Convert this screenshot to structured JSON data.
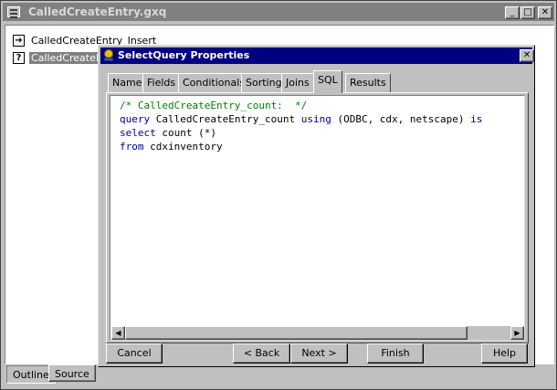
{
  "outer_window": {
    "title": "CalledCreateEntry.gxq",
    "minimize": "_",
    "maximize": "□",
    "close": "✕",
    "tree": [
      {
        "icon": "insert-query-icon",
        "glyph": "➔",
        "label": "CalledCreateEntry_Insert"
      },
      {
        "icon": "query-icon",
        "glyph": "?",
        "label": "CalledCreateEn"
      }
    ],
    "tabs": [
      "Outline",
      "Source"
    ]
  },
  "dialog": {
    "title": "SelectQuery Properties",
    "close": "✕",
    "tabs": [
      "Name",
      "Fields",
      "Conditionals",
      "Sorting",
      "Joins",
      "SQL",
      "Results"
    ],
    "active_tab": "SQL",
    "sql": {
      "line1_comment": "/* CalledCreateEntry_count:  */",
      "line2_kw1": "query",
      "line2_name": " CalledCreateEntry_count ",
      "line2_kw2": "using",
      "line2_args": " (ODBC, cdx, netscape) ",
      "line2_kw3": "is",
      "line3_kw": "select",
      "line3_rest": " count (*)",
      "line4_kw": "from",
      "line4_rest": " cdxinventory"
    },
    "scroll_left": "◀",
    "scroll_right": "▶",
    "buttons": {
      "cancel": "Cancel",
      "back": "< Back",
      "next": "Next >",
      "finish": "Finish",
      "help": "Help"
    }
  }
}
